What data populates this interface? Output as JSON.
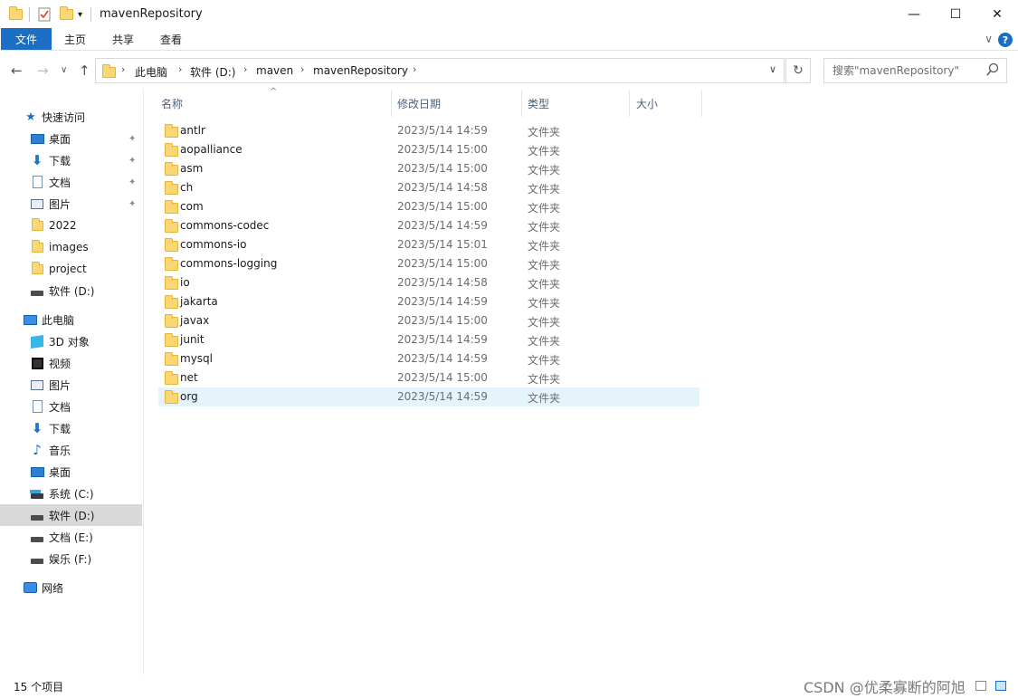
{
  "window": {
    "title": "mavenRepository",
    "minimize": "—",
    "maximize": "☐",
    "close": "✕"
  },
  "quick_access_toolbar": {
    "dropdown": "▾"
  },
  "ribbon": {
    "tabs": [
      {
        "label": "文件",
        "active": true
      },
      {
        "label": "主页",
        "active": false
      },
      {
        "label": "共享",
        "active": false
      },
      {
        "label": "查看",
        "active": false
      }
    ],
    "collapse_glyph": "∨",
    "help_glyph": "?"
  },
  "navigation": {
    "back": "←",
    "forward": "→",
    "recent": "∨",
    "up": "↑",
    "breadcrumb": [
      "此电脑",
      "软件 (D:)",
      "maven",
      "mavenRepository"
    ],
    "separator": "›",
    "address_dropdown": "∨",
    "refresh": "↻"
  },
  "search": {
    "placeholder": "搜索\"mavenRepository\""
  },
  "sidebar": {
    "quick_access": {
      "label": "快速访问"
    },
    "quick_items": [
      {
        "label": "桌面",
        "icon": "desktop-icon",
        "pinned": true
      },
      {
        "label": "下载",
        "icon": "download-icon",
        "pinned": true
      },
      {
        "label": "文档",
        "icon": "document-icon",
        "pinned": true
      },
      {
        "label": "图片",
        "icon": "picture-icon",
        "pinned": true
      },
      {
        "label": "2022",
        "icon": "folder-icon",
        "pinned": false
      },
      {
        "label": "images",
        "icon": "folder-icon",
        "pinned": false
      },
      {
        "label": "project",
        "icon": "folder-icon",
        "pinned": false
      },
      {
        "label": "软件 (D:)",
        "icon": "drive-icon",
        "pinned": false
      }
    ],
    "this_pc": {
      "label": "此电脑"
    },
    "pc_items": [
      {
        "label": "3D 对象",
        "icon": "3d-objects-icon"
      },
      {
        "label": "视频",
        "icon": "video-icon"
      },
      {
        "label": "图片",
        "icon": "picture-icon"
      },
      {
        "label": "文档",
        "icon": "document-icon"
      },
      {
        "label": "下载",
        "icon": "download-icon"
      },
      {
        "label": "音乐",
        "icon": "music-icon"
      },
      {
        "label": "桌面",
        "icon": "desktop-icon"
      },
      {
        "label": "系统 (C:)",
        "icon": "system-drive-icon"
      },
      {
        "label": "软件 (D:)",
        "icon": "drive-icon",
        "selected": true
      },
      {
        "label": "文档 (E:)",
        "icon": "drive-icon"
      },
      {
        "label": "娱乐 (F:)",
        "icon": "drive-icon"
      }
    ],
    "network": {
      "label": "网络"
    },
    "pin_glyph": "📌"
  },
  "file_list": {
    "columns": {
      "name": "名称",
      "date": "修改日期",
      "type": "类型",
      "size": "大小"
    },
    "sort_caret": "^",
    "rows": [
      {
        "name": "antlr",
        "date": "2023/5/14 14:59",
        "type": "文件夹"
      },
      {
        "name": "aopalliance",
        "date": "2023/5/14 15:00",
        "type": "文件夹"
      },
      {
        "name": "asm",
        "date": "2023/5/14 15:00",
        "type": "文件夹"
      },
      {
        "name": "ch",
        "date": "2023/5/14 14:58",
        "type": "文件夹"
      },
      {
        "name": "com",
        "date": "2023/5/14 15:00",
        "type": "文件夹"
      },
      {
        "name": "commons-codec",
        "date": "2023/5/14 14:59",
        "type": "文件夹"
      },
      {
        "name": "commons-io",
        "date": "2023/5/14 15:01",
        "type": "文件夹"
      },
      {
        "name": "commons-logging",
        "date": "2023/5/14 15:00",
        "type": "文件夹"
      },
      {
        "name": "io",
        "date": "2023/5/14 14:58",
        "type": "文件夹"
      },
      {
        "name": "jakarta",
        "date": "2023/5/14 14:59",
        "type": "文件夹"
      },
      {
        "name": "javax",
        "date": "2023/5/14 15:00",
        "type": "文件夹"
      },
      {
        "name": "junit",
        "date": "2023/5/14 14:59",
        "type": "文件夹"
      },
      {
        "name": "mysql",
        "date": "2023/5/14 14:59",
        "type": "文件夹"
      },
      {
        "name": "net",
        "date": "2023/5/14 15:00",
        "type": "文件夹"
      },
      {
        "name": "org",
        "date": "2023/5/14 14:59",
        "type": "文件夹",
        "hovered": true
      }
    ]
  },
  "status_bar": {
    "item_count": "15 个项目",
    "watermark": "CSDN @优柔寡断的阿旭"
  },
  "colors": {
    "accent": "#1a6fc4",
    "selection": "#d9d9d9",
    "hover": "#e5f3fb",
    "folder": "#f8d775"
  }
}
